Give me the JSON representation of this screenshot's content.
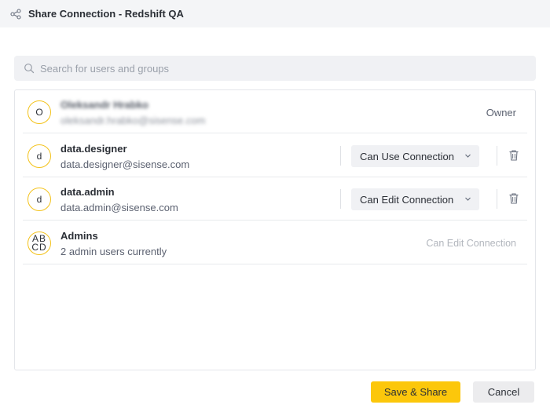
{
  "dialog": {
    "title": "Share Connection - Redshift QA",
    "icon": "share-icon"
  },
  "search": {
    "placeholder": "Search for users and groups",
    "value": ""
  },
  "users": [
    {
      "avatar": "O",
      "name": "Oleksandr Hrabko",
      "email": "oleksandr.hrabko@sisense.com",
      "role": "Owner",
      "blurred": true
    },
    {
      "avatar": "d",
      "name": "data.designer",
      "email": "data.designer@sisense.com",
      "role": "Can Use Connection"
    },
    {
      "avatar": "d",
      "name": "data.admin",
      "email": "data.admin@sisense.com",
      "role": "Can Edit Connection"
    },
    {
      "avatar_top": "AB",
      "avatar_bottom": "CD",
      "name": "Admins",
      "email": "2 admin users currently",
      "role": "Can Edit Connection"
    }
  ],
  "buttons": {
    "save": "Save & Share",
    "cancel": "Cancel"
  },
  "colors": {
    "accent": "#fcc70b",
    "avatar_border": "#f3c21a"
  }
}
